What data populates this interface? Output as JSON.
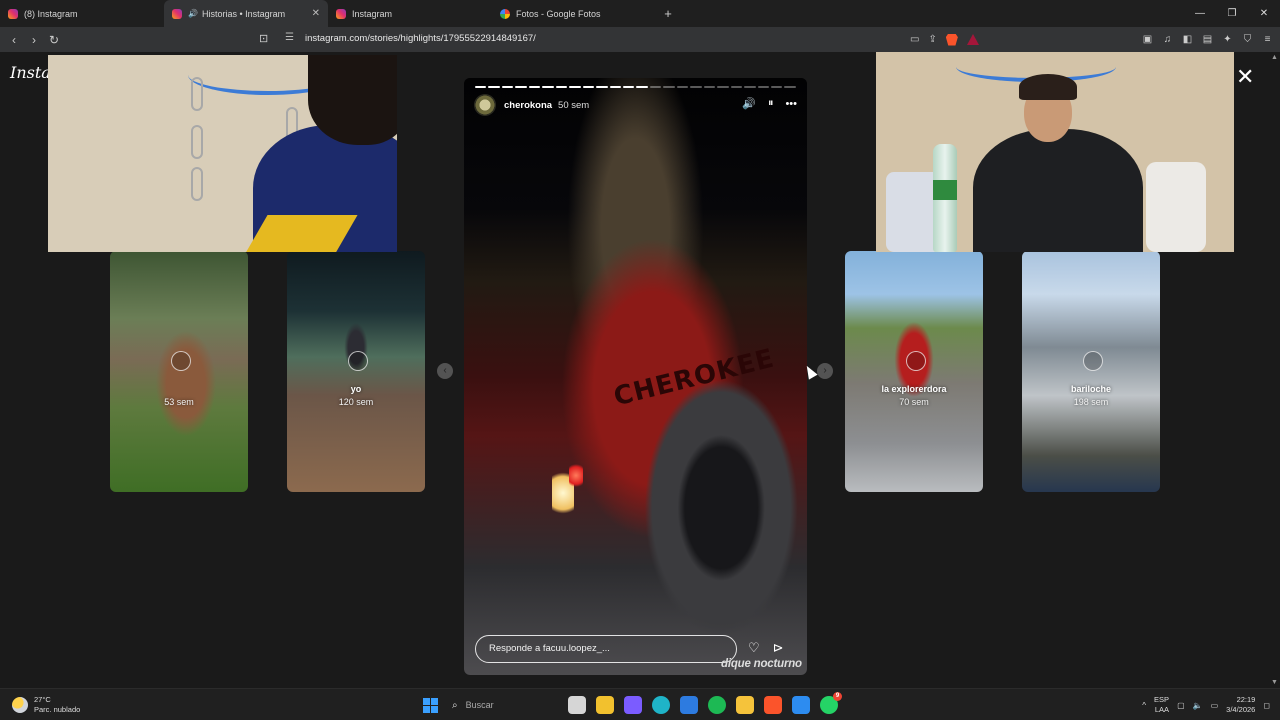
{
  "browser": {
    "tabs": [
      {
        "title": "(8) Instagram",
        "favicon": "instagram-icon",
        "active": false
      },
      {
        "title": "Historias • Instagram",
        "favicon": "instagram-icon",
        "active": true,
        "audio": true
      },
      {
        "title": "Instagram",
        "favicon": "instagram-icon",
        "active": false
      },
      {
        "title": "Fotos - Google Fotos",
        "favicon": "google-photos-icon",
        "active": false
      }
    ],
    "new_tab": "+",
    "url": "instagram.com/stories/highlights/17955522914849167/",
    "window_controls": [
      "—",
      "❐",
      "✕"
    ]
  },
  "page": {
    "logo": "Instagram",
    "close": "✕",
    "prev_arrow": "‹",
    "next_arrow": "›"
  },
  "story": {
    "username": "cherokona",
    "time": "50 sem",
    "segments_total": 24,
    "segments_done": 13,
    "hood_text": "CHEROKEE",
    "reply_placeholder": "Responde a facuu.loopez_...",
    "watermark": "dique nocturno",
    "controls": {
      "mute": "🔊",
      "pause": "⏸",
      "more": "•••"
    },
    "actions": {
      "like": "♡",
      "share": "⊳"
    }
  },
  "highlights": [
    {
      "name": "",
      "age": "53 sem"
    },
    {
      "name": "yo",
      "age": "120 sem"
    },
    {
      "name": "la explorerdora",
      "age": "70 sem"
    },
    {
      "name": "bariloche",
      "age": "198 sem"
    }
  ],
  "taskbar": {
    "weather_temp": "27°C",
    "weather_desc": "Parc. nublado",
    "search_placeholder": "Buscar",
    "lang_top": "ESP",
    "lang_bottom": "LAA",
    "time": "22:19",
    "date": "3/4/2026",
    "whatsapp_badge": "9",
    "apps": [
      {
        "name": "task-view-icon",
        "color": "#d6d6d6"
      },
      {
        "name": "file-explorer-icon",
        "color": "#f2c12e"
      },
      {
        "name": "copilot-icon",
        "color": "#7b5cff"
      },
      {
        "name": "edge-icon",
        "color": "#1fb4c8"
      },
      {
        "name": "store-icon",
        "color": "#2d7be0"
      },
      {
        "name": "spotify-icon",
        "color": "#1db954"
      },
      {
        "name": "folder-icon",
        "color": "#f5c33b"
      },
      {
        "name": "brave-icon",
        "color": "#fb542b"
      },
      {
        "name": "paint-icon",
        "color": "#2d8cf0"
      },
      {
        "name": "whatsapp-icon",
        "color": "#25d366"
      }
    ]
  }
}
